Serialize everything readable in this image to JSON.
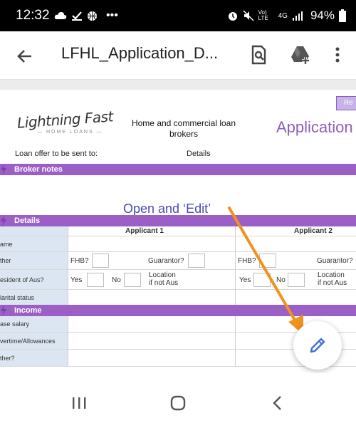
{
  "status_bar": {
    "time": "12:32",
    "battery_percent": "94%",
    "network": "4G",
    "volte": "Vo) LTE"
  },
  "app_bar": {
    "title": "LFHL_Application_D...",
    "back_icon": "arrow-back-icon",
    "search_icon": "find-in-document-icon",
    "drive_icon": "add-to-drive-icon",
    "more_icon": "more-vert-icon"
  },
  "document": {
    "logo": {
      "main": "Lightning Fast",
      "sub": "— HOME LOANS —"
    },
    "company_line": "Home and commercial loan brokers",
    "heading": "Application",
    "top_tab": "Re",
    "loan_offer_label": "Loan offer to be sent to:",
    "loan_offer_details": "Details",
    "sections": {
      "broker_notes": "Broker notes",
      "details": "Details",
      "income": "Income"
    },
    "overlay_instruction": "Open and ‘Edit’",
    "applicant_1": "Applicant 1",
    "applicant_2": "Applicant 2",
    "row_labels": {
      "name": "ame",
      "other": "ther",
      "resident": "esident of Aus?",
      "marital": "larital status",
      "base_salary": "ase salary",
      "overtime": "vertime/Allowances",
      "other2": "ther?"
    },
    "fields": {
      "fhb": "FHB?",
      "guarantor": "Guarantor?",
      "yes": "Yes",
      "no": "No",
      "location": "Location",
      "if_not_aus": "if not Aus"
    }
  },
  "colors": {
    "section_purple": "#9b5fc5",
    "heading_purple": "#8b5fbf",
    "annotation_orange": "#f0921e",
    "overlay_text_blue": "#4a4ab0",
    "fab_pencil_blue": "#3d6fd8"
  },
  "fab": {
    "icon": "edit-pencil-icon"
  }
}
